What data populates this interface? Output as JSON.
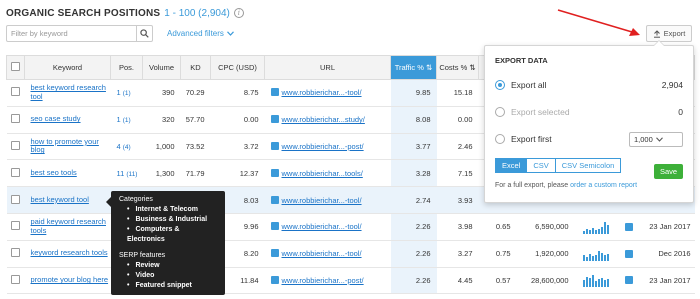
{
  "header": {
    "title": "ORGANIC SEARCH POSITIONS",
    "range": "1 - 100 (2,904)",
    "info_icon": "i"
  },
  "filter": {
    "placeholder": "Filter by keyword",
    "advanced_label": "Advanced filters"
  },
  "export_button": {
    "label": "Export"
  },
  "table": {
    "columns": [
      "Keyword",
      "Pos.",
      "Volume",
      "KD",
      "CPC (USD)",
      "URL",
      "Traffic %",
      "Costs %"
    ],
    "rows": [
      {
        "keyword": "best keyword research tool",
        "pos": "1",
        "pos_prev": "(1)",
        "volume": "390",
        "kd": "70.29",
        "cpc": "8.75",
        "url": "www.robbierichar...-tool/",
        "traffic": "9.85",
        "costs": "15.18"
      },
      {
        "keyword": "seo case study",
        "pos": "1",
        "pos_prev": "(1)",
        "volume": "320",
        "kd": "57.70",
        "cpc": "0.00",
        "url": "www.robbierichar...study/",
        "traffic": "8.08",
        "costs": "0.00"
      },
      {
        "keyword": "how to promote your blog",
        "pos": "4",
        "pos_prev": "(4)",
        "volume": "1,000",
        "kd": "73.52",
        "cpc": "3.72",
        "url": "www.robbierichar...-post/",
        "traffic": "3.77",
        "costs": "2.46"
      },
      {
        "keyword": "best seo tools",
        "pos": "11",
        "pos_prev": "(11)",
        "volume": "1,300",
        "kd": "71.79",
        "cpc": "12.37",
        "url": "www.robbierichar...tools/",
        "traffic": "3.28",
        "costs": "7.15"
      },
      {
        "keyword": "best keyword tool",
        "pos": "",
        "pos_prev": "",
        "volume": "",
        "kd": "",
        "cpc": "8.03",
        "url": "www.robbierichar...-tool/",
        "traffic": "2.74",
        "costs": "3.93"
      },
      {
        "keyword": "paid keyword research tools",
        "pos": "",
        "pos_prev": "",
        "volume": "",
        "kd": "",
        "cpc": "9.96",
        "url": "www.robbierichar...-tool/",
        "traffic": "2.26",
        "costs": "3.98",
        "extra1": "0.65",
        "extra2": "6,590,000",
        "date": "23 Jan 2017"
      },
      {
        "keyword": "keyword research tools",
        "pos": "",
        "pos_prev": "",
        "volume": "",
        "kd": "",
        "cpc": "8.20",
        "url": "www.robbierichar...-tool/",
        "traffic": "2.26",
        "costs": "3.27",
        "extra1": "0.75",
        "extra2": "1,920,000",
        "date": "Dec 2016"
      },
      {
        "keyword": "promote your blog here",
        "pos": "",
        "pos_prev": "",
        "volume": "",
        "kd": "",
        "cpc": "11.84",
        "url": "www.robbierichar...-post/",
        "traffic": "2.26",
        "costs": "4.45",
        "extra1": "0.57",
        "extra2": "28,600,000",
        "date": "23 Jan 2017"
      }
    ]
  },
  "tooltip": {
    "categories_title": "Categories",
    "categories": [
      "Internet & Telecom",
      "Business & Industrial",
      "Computers & Electronics"
    ],
    "serp_title": "SERP features",
    "serp": [
      "Review",
      "Video",
      "Featured snippet"
    ]
  },
  "export_panel": {
    "title": "EXPORT DATA",
    "export_all": "Export all",
    "export_all_count": "2,904",
    "export_selected": "Export selected",
    "export_selected_count": "0",
    "export_first": "Export first",
    "export_first_value": "1,000",
    "formats": [
      "Excel",
      "CSV",
      "CSV Semicolon"
    ],
    "save": "Save",
    "note": "For a full export, please",
    "note_link": "order a custom report"
  },
  "colors": {
    "accent": "#3b9ad9",
    "save": "#3db039",
    "arrow": "#e02020"
  }
}
